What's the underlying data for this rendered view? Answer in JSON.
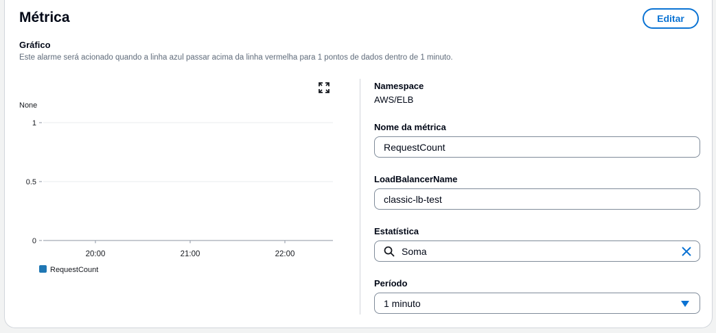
{
  "header": {
    "title": "Métrica",
    "edit_label": "Editar"
  },
  "graph": {
    "label": "Gráfico",
    "description": "Este alarme será acionado quando a linha azul passar acima da linha vermelha para 1 pontos de dados dentro de 1 minuto."
  },
  "chart_data": {
    "type": "line",
    "ylabel": "None",
    "ylim": [
      0,
      1
    ],
    "yticks": [
      "1",
      "0.5",
      "0"
    ],
    "xticks": [
      "20:00",
      "21:00",
      "22:00"
    ],
    "grid": true,
    "legend_position": "bottom-left",
    "series": [
      {
        "name": "RequestCount",
        "color": "#1f77b4",
        "values": []
      }
    ]
  },
  "details": {
    "namespace_label": "Namespace",
    "namespace_value": "AWS/ELB",
    "metric_name_label": "Nome da métrica",
    "metric_name_value": "RequestCount",
    "lb_label": "LoadBalancerName",
    "lb_value": "classic-lb-test",
    "statistic_label": "Estatística",
    "statistic_value": "Soma",
    "period_label": "Período",
    "period_value": "1 minuto"
  },
  "icons": {
    "expand": "expand-icon",
    "search": "search-icon",
    "clear": "close-icon",
    "dropdown": "caret-down-icon"
  },
  "colors": {
    "accent": "#0972d3",
    "series_blue": "#1f77b4"
  }
}
